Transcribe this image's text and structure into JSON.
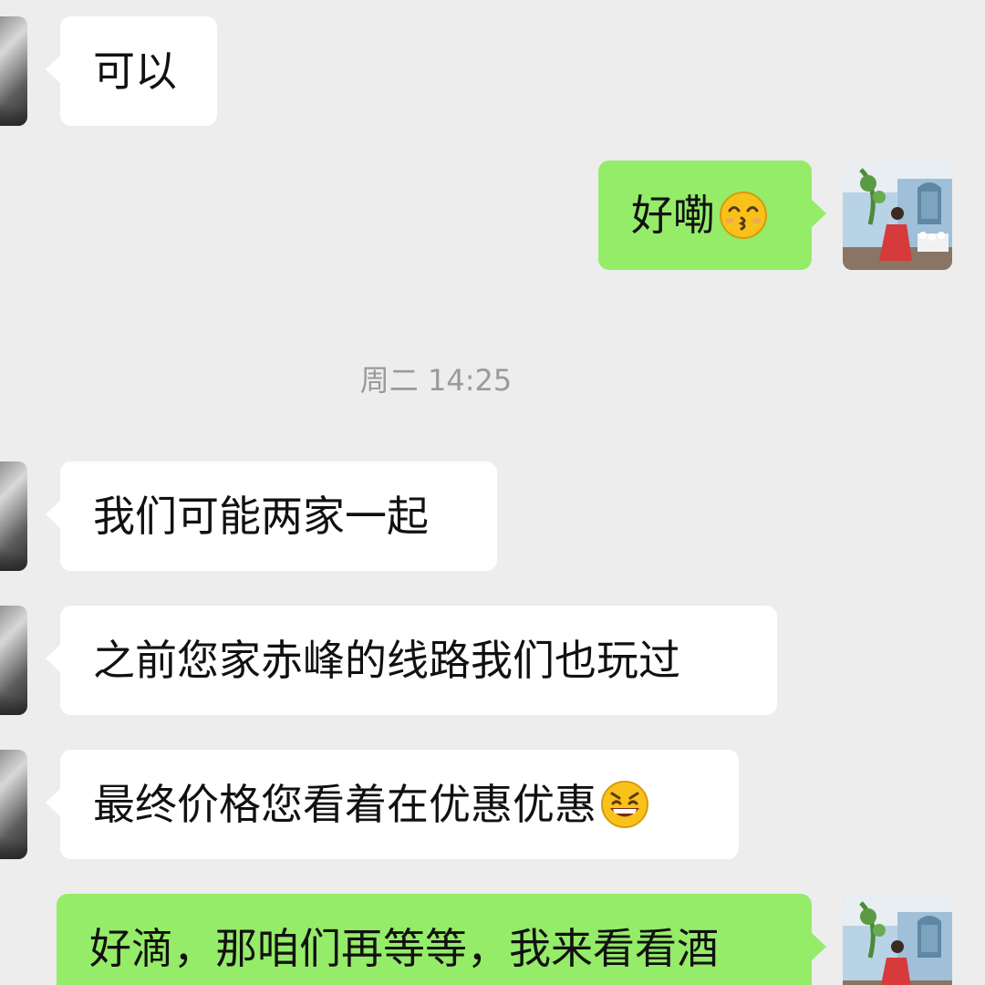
{
  "timestamp": "周二 14:25",
  "messages": [
    {
      "side": "left",
      "text": "可以"
    },
    {
      "side": "right",
      "text": "好嘞",
      "emoji": "kissing-face-emoji"
    },
    {
      "side": "left",
      "text": "我们可能两家一起"
    },
    {
      "side": "left",
      "text": "之前您家赤峰的线路我们也玩过"
    },
    {
      "side": "left",
      "text": "最终价格您看着在优惠优惠",
      "emoji": "grinning-face-emoji"
    },
    {
      "side": "right",
      "text": "好滴，那咱们再等等，我来看看酒"
    }
  ],
  "colors": {
    "background": "#ededed",
    "incoming_bubble": "#ffffff",
    "outgoing_bubble": "#95ec69",
    "timestamp_text": "#9a9a9a"
  },
  "icons": [
    "contact-avatar",
    "user-avatar",
    "kissing-face-emoji",
    "grinning-face-emoji"
  ]
}
